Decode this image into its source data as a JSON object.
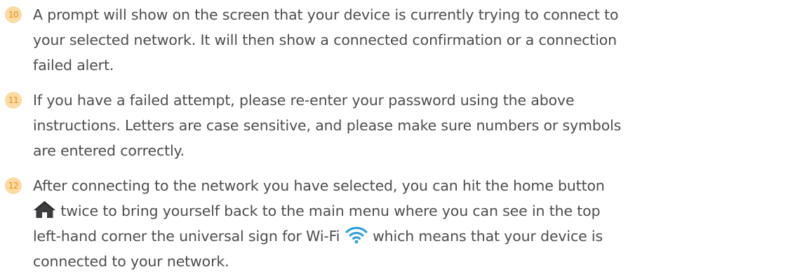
{
  "steps": [
    {
      "number": "10",
      "lines": [
        "A prompt will show on the screen that your device is currently trying to connect to",
        "your selected network. It will then show a connected confirmation or a connection",
        "failed alert."
      ]
    },
    {
      "number": "11",
      "lines": [
        "If you have a failed attempt, please re-enter your password using the above",
        "instructions. Letters are case sensitive, and please make sure numbers or symbols",
        "are entered correctly."
      ]
    },
    {
      "number": "12",
      "line1": "After connecting to the network you have selected, you can hit the home button",
      "line2_after_icon": " twice to bring yourself back to the main menu where you can see in the top",
      "line3_before_icon": "left-hand corner the universal sign for Wi-Fi ",
      "line3_after_icon": " which means that your device is",
      "line4": "connected to your network."
    }
  ],
  "icons": {
    "home": "home-icon",
    "wifi": "wifi-icon"
  },
  "colors": {
    "text": "#4d4d4f",
    "badge_bg": "#fbdba3",
    "badge_text": "#e1901a",
    "icon_dark": "#3d3d3f",
    "wifi_blue": "#2a9fd8"
  }
}
